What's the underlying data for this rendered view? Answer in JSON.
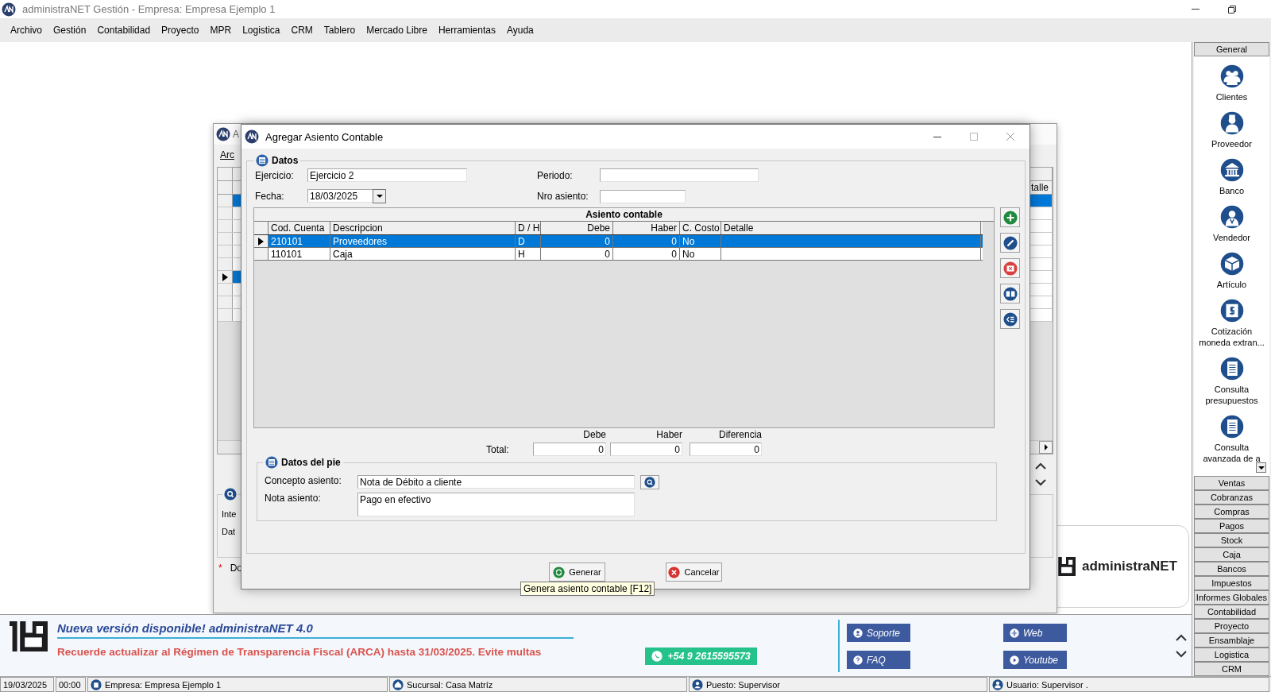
{
  "app": {
    "title": "administraNET Gestión - Empresa: Empresa Ejemplo 1"
  },
  "menu": [
    "Archivo",
    "Gestión",
    "Contabilidad",
    "Proyecto",
    "MPR",
    "Logistica",
    "CRM",
    "Tablero",
    "Mercado Libre",
    "Herramientas",
    "Ayuda"
  ],
  "background_window": {
    "title": "A",
    "menu": "Arc",
    "last_column": "talle",
    "rows": [
      {
        "selected": true,
        "current": false
      },
      {
        "selected": false,
        "current": false
      },
      {
        "selected": false,
        "current": false
      },
      {
        "selected": false,
        "current": false
      },
      {
        "selected": false,
        "current": false
      },
      {
        "selected": false,
        "current": false
      },
      {
        "selected": false,
        "current": true
      },
      {
        "selected": false,
        "current": false
      },
      {
        "selected": false,
        "current": false
      },
      {
        "selected": false,
        "current": false
      }
    ],
    "fields": [
      "Inte",
      "Dat"
    ],
    "note_mark": "*",
    "note": "Do"
  },
  "dialog": {
    "title": "Agregar Asiento Contable",
    "datos": {
      "legend": "Datos",
      "ejercicio": {
        "label": "Ejercicio:",
        "value": "Ejercicio 2"
      },
      "periodo": {
        "label": "Periodo:"
      },
      "fecha": {
        "label": "Fecha:",
        "value": "18/03/2025"
      },
      "nro_asiento": {
        "label": "Nro asiento:"
      }
    },
    "grid": {
      "title": "Asiento contable",
      "columns": [
        "Cod. Cuenta",
        "Descripcion",
        "D / H",
        "Debe",
        "Haber",
        "C. Costo",
        "Detalle"
      ],
      "rows": [
        {
          "selected": true,
          "cells": [
            "210101",
            "Proveedores",
            "D",
            "0",
            "0",
            "No"
          ]
        },
        {
          "selected": false,
          "cells": [
            "110101",
            "Caja",
            "H",
            "0",
            "0",
            "No"
          ]
        }
      ]
    },
    "toolbar": [
      {
        "kind": "add"
      },
      {
        "kind": "edit"
      },
      {
        "kind": "delete"
      },
      {
        "kind": "columns"
      },
      {
        "kind": "list"
      }
    ],
    "totals": {
      "label": "Total:",
      "columns": [
        {
          "header": "Debe",
          "value": "0"
        },
        {
          "header": "Haber",
          "value": "0"
        },
        {
          "header": "Diferencia",
          "value": "0"
        }
      ]
    },
    "pie": {
      "legend": "Datos del pie",
      "concepto": {
        "label": "Concepto asiento:",
        "value": "Nota de Débito a cliente"
      },
      "nota": {
        "label": "Nota asiento:",
        "value": "Pago en efectivo"
      }
    },
    "buttons": [
      {
        "kind": "generate",
        "label": "Generar"
      },
      {
        "kind": "cancel",
        "label": "Cancelar"
      }
    ],
    "tooltip": "Genera asiento contable [F12]"
  },
  "logo_card": {
    "name": "administraNET"
  },
  "sidebar": {
    "header": "General",
    "items": [
      {
        "label": "Clientes",
        "kind": "clients"
      },
      {
        "label": "Proveedor",
        "kind": "supplier"
      },
      {
        "label": "Banco",
        "kind": "bank"
      },
      {
        "label": "Vendedor",
        "kind": "seller"
      },
      {
        "label": "Artículo",
        "kind": "article"
      },
      {
        "label": "Cotización moneda extran...",
        "kind": "currency"
      },
      {
        "label": "Consulta presupuestos",
        "kind": "document"
      },
      {
        "label": "Consulta avanzada de a",
        "kind": "document"
      }
    ],
    "sections": [
      "Ventas",
      "Cobranzas",
      "Compras",
      "Pagos",
      "Stock",
      "Caja",
      "Bancos",
      "Impuestos",
      "Informes Globales",
      "Contabilidad",
      "Proyecto",
      "Ensamblaje",
      "Logistica",
      "CRM"
    ]
  },
  "banner": {
    "headline": "Nueva versión disponible! administraNET 4.0",
    "notice": "Recuerde actualizar al Régimen de Transparencia Fiscal (ARCA) hasta 31/03/2025. Evite multas",
    "whatsapp": "+54 9 2615595573",
    "links": [
      {
        "label": "Soporte",
        "kind": "support"
      },
      {
        "label": "Web",
        "kind": "web"
      },
      {
        "label": "FAQ",
        "kind": "help"
      },
      {
        "label": "Youtube",
        "kind": "video"
      }
    ]
  },
  "status_bar": [
    {
      "text": "19/03/2025",
      "kind": "plain"
    },
    {
      "text": "00:00",
      "kind": "plain"
    },
    {
      "text": "Empresa: Empresa Ejemplo 1",
      "kind": "company"
    },
    {
      "text": "Sucursal: Casa Matríz",
      "kind": "branch"
    },
    {
      "text": "Puesto: Supervisor",
      "kind": "post"
    },
    {
      "text": "Usuario: Supervisor .",
      "kind": "user"
    }
  ]
}
